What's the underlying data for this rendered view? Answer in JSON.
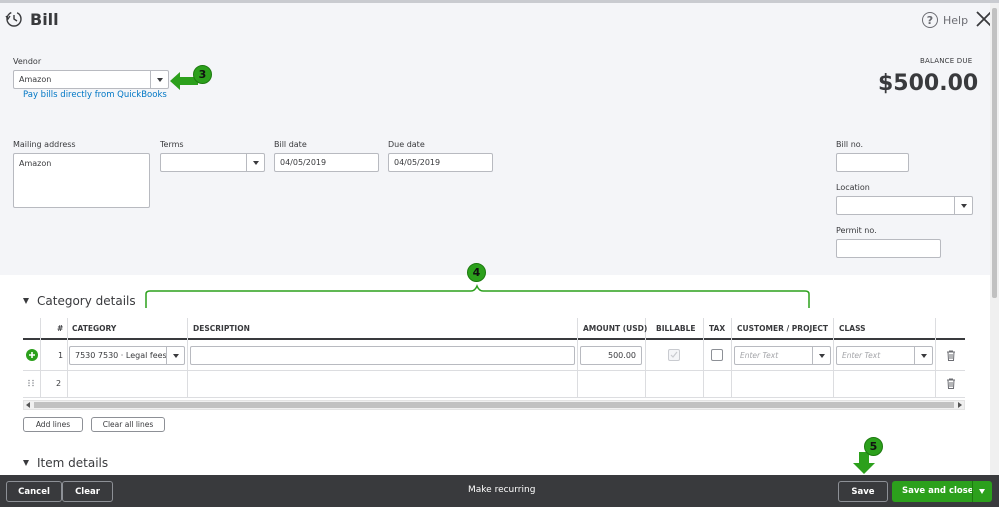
{
  "header": {
    "title": "Bill",
    "help_label": "Help"
  },
  "vendor": {
    "label": "Vendor",
    "value": "Amazon",
    "pay_link": "Pay bills directly from QuickBooks"
  },
  "balance": {
    "label": "BALANCE DUE",
    "amount": "$500.00"
  },
  "form": {
    "mailing_address_label": "Mailing address",
    "mailing_address_value": "Amazon",
    "terms_label": "Terms",
    "terms_value": "",
    "bill_date_label": "Bill date",
    "bill_date_value": "04/05/2019",
    "due_date_label": "Due date",
    "due_date_value": "04/05/2019",
    "bill_no_label": "Bill no.",
    "bill_no_value": "",
    "location_label": "Location",
    "location_value": "",
    "permit_no_label": "Permit no.",
    "permit_no_value": ""
  },
  "callouts": {
    "c3": "3",
    "c4": "4",
    "c5": "5"
  },
  "category_details": {
    "title": "Category details",
    "columns": {
      "num": "#",
      "category": "CATEGORY",
      "description": "DESCRIPTION",
      "amount": "AMOUNT (USD)",
      "billable": "BILLABLE",
      "tax": "TAX",
      "customer": "CUSTOMER / PROJECT",
      "class": "CLASS"
    },
    "rows": [
      {
        "num": "1",
        "category": "7530 7530 · Legal fees",
        "description": "",
        "amount": "500.00",
        "customer_placeholder": "Enter Text",
        "class_placeholder": "Enter Text"
      },
      {
        "num": "2"
      }
    ],
    "add_lines": "Add lines",
    "clear_all_lines": "Clear all lines"
  },
  "item_details": {
    "title": "Item details"
  },
  "footer": {
    "cancel": "Cancel",
    "clear": "Clear",
    "make_recurring": "Make recurring",
    "save": "Save",
    "save_and_close": "Save and close"
  },
  "colors": {
    "brand_green": "#2ca01c",
    "link_blue": "#0077c5",
    "footer_bg": "#393a3d"
  }
}
